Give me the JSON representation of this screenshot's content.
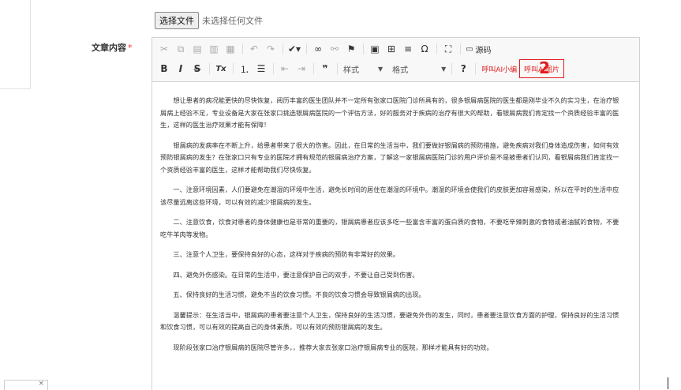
{
  "file_upload": {
    "button_label": "选择文件",
    "status": "未选择任何文件"
  },
  "field": {
    "label": "文章内容",
    "required_mark": "*"
  },
  "toolbar": {
    "source_label": "源码",
    "style_label": "样式",
    "format_label": "格式",
    "help_label": "?",
    "ai_assistant_label": "呼叫AI小编",
    "ai_image_label": "呼叫AI图片",
    "annotation_number": "2",
    "bold": "B",
    "italic": "I",
    "strike": "S",
    "clear_format": "Tx",
    "quote": "❞"
  },
  "colors": {
    "accent_red": "#e21d1d"
  },
  "content": {
    "paragraphs": [
      "想让患者的病况能更快的尽快恢复，阅历丰富的医生团队并不一定所有张家口医院门诊所具有的，很多银屑病医院的医生都是刚毕业不久的实习生，在治疗银屑病上经验不足，专业设备是大家在张家口挑选银屑病医院的一个评估方法，好的服务对于疾病的治疗有很大的帮助，看银屑病我们肯定找一个资质经验丰富的医生，这样的医生治疗效果才能有保障！",
      "银屑病的发病率在不断上升，给患者带来了很大的伤害。因此，在日常的生活当中，我们要做好银屑病的预防措施，避免疾病对我们身体造成伤害，如何有效预防银屑病的发生？在张家口只有专业的医院才拥有规范的银屑病治疗方案，了解这一家银屑病医院门诊的用户评价是不是被患者们认同，看银屑病我们肯定找一个资质经验丰富的医生，这样才能帮助我们尽快恢复。",
      "一、注意环境因素，人们要避免在潮湿的环境中生活，避免长时间的居住在潮湿的环境中。潮湿的环境会使我们的皮肤更加容易感染，所以在平时的生活中应该尽量远离这些环境，可以有效的减少银屑病的发生。",
      "二、注意饮食，饮食对患者的身体健康也是非常的重要的，银屑病患者应该多吃一些富含丰富的蛋白质的食物，不要吃辛辣刺激的食物或者油腻的食物，不要吃牛羊肉等发物。",
      "三、注意个人卫生，要保持良好的心态，这样对于疾病的预防有非常好的效果。",
      "四、避免外伤感染。在日常的生活中，要注意保护自己的双手，不要让自己受到伤害。",
      "五、保持良好的生活习惯，避免不当的饮食习惯。不良的饮食习惯会导致银屑病的出现。",
      "温馨提示：在生活当中，银屑病的患者要注意个人卫生，保持良好的生活习惯，要避免外伤的发生，同时，患者要注意饮食方面的护理，保持良好的生活习惯和饮食习惯，可以有效的提高自己的身体素质，可以有效的预防银屑病的发生。",
      "现阶段张家口治疗银屑病的医院尽管许多，，推荐大家去张家口治疗银屑病专业的医院，那样才能具有好的功效。"
    ]
  },
  "bottom_field": {
    "close_glyph": "×"
  }
}
